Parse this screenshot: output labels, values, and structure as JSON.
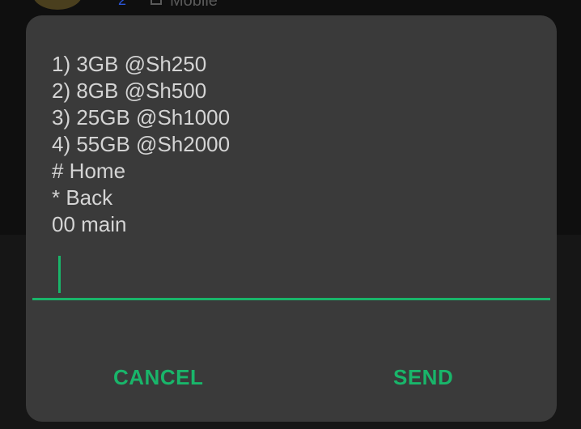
{
  "background": {
    "badge": "2",
    "label": "Mobile"
  },
  "dialog": {
    "message_lines": [
      "1) 3GB @Sh250",
      "2) 8GB @Sh500",
      "3) 25GB @Sh1000",
      "4) 55GB @Sh2000",
      "# Home",
      "* Back",
      "00 main"
    ],
    "input_value": "",
    "buttons": {
      "cancel_label": "CANCEL",
      "send_label": "SEND"
    }
  },
  "colors": {
    "accent": "#19b56a",
    "dialog_bg": "#3a3a3a",
    "text": "#d4d4d4"
  }
}
